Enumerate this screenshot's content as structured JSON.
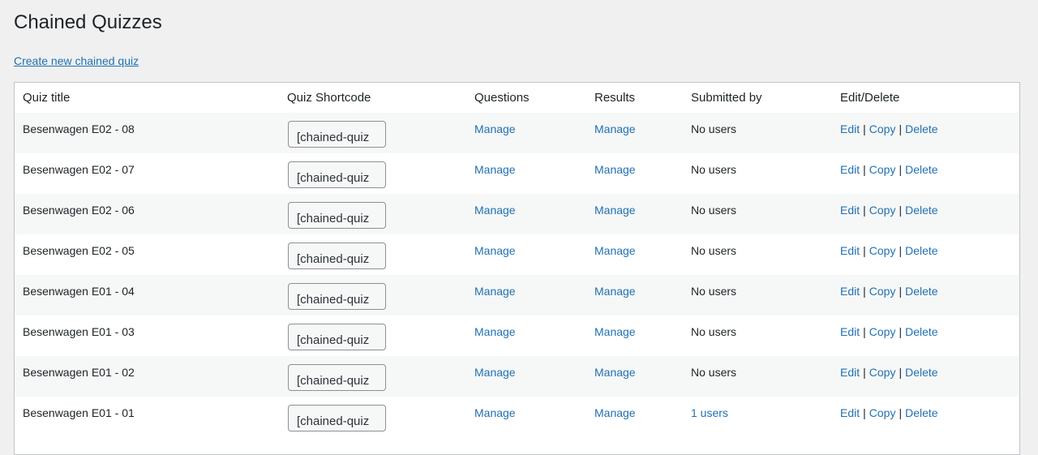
{
  "page": {
    "title": "Chained Quizzes",
    "create_link": "Create new chained quiz"
  },
  "table": {
    "headers": [
      "Quiz title",
      "Quiz Shortcode",
      "Questions",
      "Results",
      "Submitted by",
      "Edit/Delete"
    ],
    "rows": [
      {
        "title": "Besenwagen E02 - 08",
        "shortcode": "[chained-quiz",
        "questions": "Manage",
        "results": "Manage",
        "submitted": "No users",
        "edit": "Edit",
        "copy": "Copy",
        "delete": "Delete"
      },
      {
        "title": "Besenwagen E02 - 07",
        "shortcode": "[chained-quiz",
        "questions": "Manage",
        "results": "Manage",
        "submitted": "No users",
        "edit": "Edit",
        "copy": "Copy",
        "delete": "Delete"
      },
      {
        "title": "Besenwagen E02 - 06",
        "shortcode": "[chained-quiz",
        "questions": "Manage",
        "results": "Manage",
        "submitted": "No users",
        "edit": "Edit",
        "copy": "Copy",
        "delete": "Delete"
      },
      {
        "title": "Besenwagen E02 - 05",
        "shortcode": "[chained-quiz",
        "questions": "Manage",
        "results": "Manage",
        "submitted": "No users",
        "edit": "Edit",
        "copy": "Copy",
        "delete": "Delete"
      },
      {
        "title": "Besenwagen E01 - 04",
        "shortcode": "[chained-quiz",
        "questions": "Manage",
        "results": "Manage",
        "submitted": "No users",
        "edit": "Edit",
        "copy": "Copy",
        "delete": "Delete"
      },
      {
        "title": "Besenwagen E01 - 03",
        "shortcode": "[chained-quiz",
        "questions": "Manage",
        "results": "Manage",
        "submitted": "No users",
        "edit": "Edit",
        "copy": "Copy",
        "delete": "Delete"
      },
      {
        "title": "Besenwagen E01 - 02",
        "shortcode": "[chained-quiz",
        "questions": "Manage",
        "results": "Manage",
        "submitted": "No users",
        "edit": "Edit",
        "copy": "Copy",
        "delete": "Delete"
      },
      {
        "title": "Besenwagen E01 - 01",
        "shortcode": "[chained-quiz",
        "questions": "Manage",
        "results": "Manage",
        "submitted": "1 users",
        "submitted_is_link": true,
        "edit": "Edit",
        "copy": "Copy",
        "delete": "Delete"
      }
    ],
    "separator": "|"
  },
  "colors": {
    "background": "#f0f0f1",
    "link": "#2271b1",
    "text": "#1d2327",
    "row_alt": "#f6f7f7"
  }
}
